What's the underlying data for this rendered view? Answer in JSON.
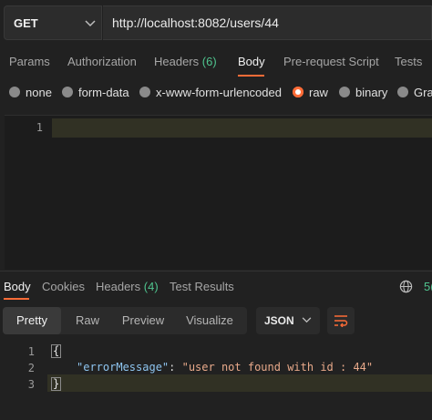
{
  "request": {
    "method": "GET",
    "url": "http://localhost:8082/users/44"
  },
  "request_tabs": {
    "params": "Params",
    "authorization": "Authorization",
    "headers": "Headers",
    "headers_count": "(6)",
    "body": "Body",
    "prerequest": "Pre-request Script",
    "tests": "Tests"
  },
  "body_types": {
    "none": "none",
    "form_data": "form-data",
    "urlencoded": "x-www-form-urlencoded",
    "raw": "raw",
    "binary": "binary",
    "graphql": "Gra"
  },
  "request_editor": {
    "line1": "1"
  },
  "response_tabs": {
    "body": "Body",
    "cookies": "Cookies",
    "headers": "Headers",
    "headers_count": "(4)",
    "test_results": "Test Results",
    "status_partial": "5("
  },
  "view_modes": {
    "pretty": "Pretty",
    "raw": "Raw",
    "preview": "Preview",
    "visualize": "Visualize"
  },
  "format": "JSON",
  "response_body": {
    "ln1": "1",
    "ln2": "2",
    "ln3": "3",
    "open_brace": "{",
    "close_brace": "}",
    "key": "\"errorMessage\"",
    "colon": ": ",
    "value": "\"user not found with id : 44\""
  },
  "colors": {
    "accent": "#ff6c37",
    "count_green": "#4fc38e"
  }
}
